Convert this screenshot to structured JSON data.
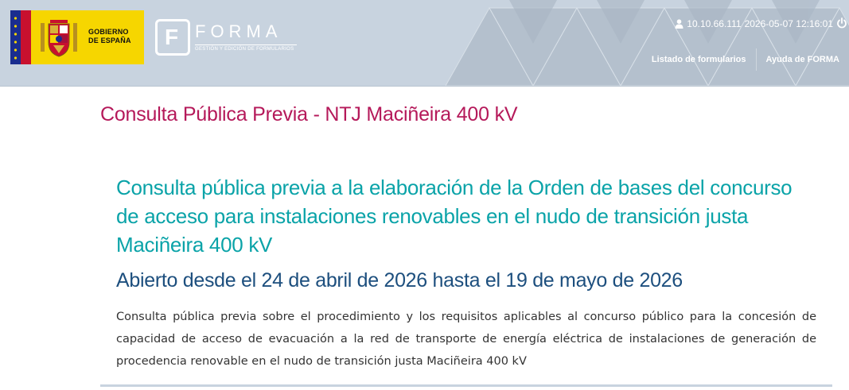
{
  "header": {
    "gov_logo_line1": "GOBIERNO",
    "gov_logo_line2": "DE ESPAÑA",
    "app_logo_letter": "F",
    "app_name": "FORMA",
    "app_tagline": "GESTIÓN Y EDICIÓN DE FORMULARIOS",
    "session_ip": "10.10.66.111",
    "session_datetime": "2026-05-07 12:16:01",
    "user_icon": "user-icon",
    "power_icon": "power-icon",
    "nav": [
      {
        "label": "Listado de formularios"
      },
      {
        "label": "Ayuda de FORMA"
      }
    ]
  },
  "main": {
    "page_title": "Consulta Pública Previa - NTJ Maciñeira 400 kV",
    "headline": "Consulta pública previa a la elaboración de la Orden de bases del concurso de acceso para instalaciones renovables en el nudo de transición justa Maciñeira 400 kV",
    "dates": "Abierto desde el 24 de abril de 2026 hasta el 19 de mayo de 2026",
    "description": "Consulta pública previa sobre el procedimiento y los requisitos aplicables al concurso público para la concesión de capacidad de acceso de evacuación a la red de transporte de energía eléctrica de instalaciones de generación de procedencia renovable en el nudo de transición justa Maciñeira 400 kV"
  },
  "colors": {
    "header_bg": "#c8d3df",
    "title_magenta": "#b5195a",
    "headline_teal": "#0aa3a8",
    "dates_navy": "#1d4f7e",
    "logo_yellow": "#f6d600"
  }
}
